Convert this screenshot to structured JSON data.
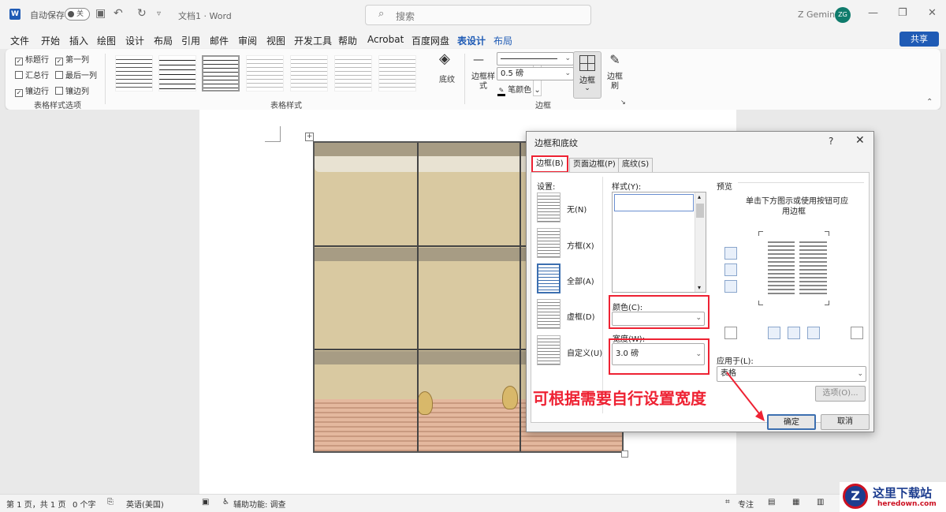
{
  "titlebar": {
    "app_icon": "W",
    "autosave_label": "自动保存",
    "autosave_state": "关",
    "doc_title": "文档1 · Word",
    "search_placeholder": "搜索",
    "user_name": "Z Gemini",
    "user_initials": "ZG"
  },
  "menu": {
    "items": [
      "文件",
      "开始",
      "插入",
      "绘图",
      "设计",
      "布局",
      "引用",
      "邮件",
      "审阅",
      "视图",
      "开发工具",
      "帮助",
      "Acrobat",
      "百度网盘",
      "表设计",
      "布局"
    ],
    "share": "共享"
  },
  "ribbon": {
    "checkboxes": [
      {
        "label": "标题行",
        "checked": true
      },
      {
        "label": "第一列",
        "checked": true
      },
      {
        "label": "汇总行",
        "checked": false
      },
      {
        "label": "最后一列",
        "checked": false
      },
      {
        "label": "镶边行",
        "checked": true
      },
      {
        "label": "镶边列",
        "checked": false
      }
    ],
    "group1_label": "表格样式选项",
    "group2_label": "表格样式",
    "shading_label": "底纹",
    "border_style_label": "边框样式",
    "pen_weight": "0.5 磅",
    "pen_color_label": "笔颜色",
    "borders_label": "边框",
    "border_painter_label": "边框刷",
    "group3_label": "边框"
  },
  "dialog": {
    "title": "边框和底纹",
    "help": "?",
    "tabs": [
      "边框(B)",
      "页面边框(P)",
      "底纹(S)"
    ],
    "settings_label": "设置:",
    "settings": [
      "无(N)",
      "方框(X)",
      "全部(A)",
      "虚框(D)",
      "自定义(U)"
    ],
    "style_label": "样式(Y):",
    "color_label": "颜色(C):",
    "width_label": "宽度(W):",
    "width_value": "3.0 磅",
    "preview_label": "预览",
    "preview_hint_1": "单击下方图示或使用按钮可应",
    "preview_hint_2": "用边框",
    "apply_label": "应用于(L):",
    "apply_value": "表格",
    "options_btn": "选项(O)...",
    "ok_btn": "确定",
    "cancel_btn": "取消"
  },
  "annotation": "可根据需要自行设置宽度",
  "status": {
    "page": "第 1 页，共 1 页",
    "words": "0 个字",
    "lang": "英语(美国)",
    "accessibility": "辅助功能: 调查",
    "focus": "专注"
  },
  "watermark": {
    "logo": "Z",
    "name": "这里下载站",
    "url": "heredown.com"
  },
  "colors": {
    "accent": "#1f5bb5",
    "highlight": "#e23333"
  }
}
